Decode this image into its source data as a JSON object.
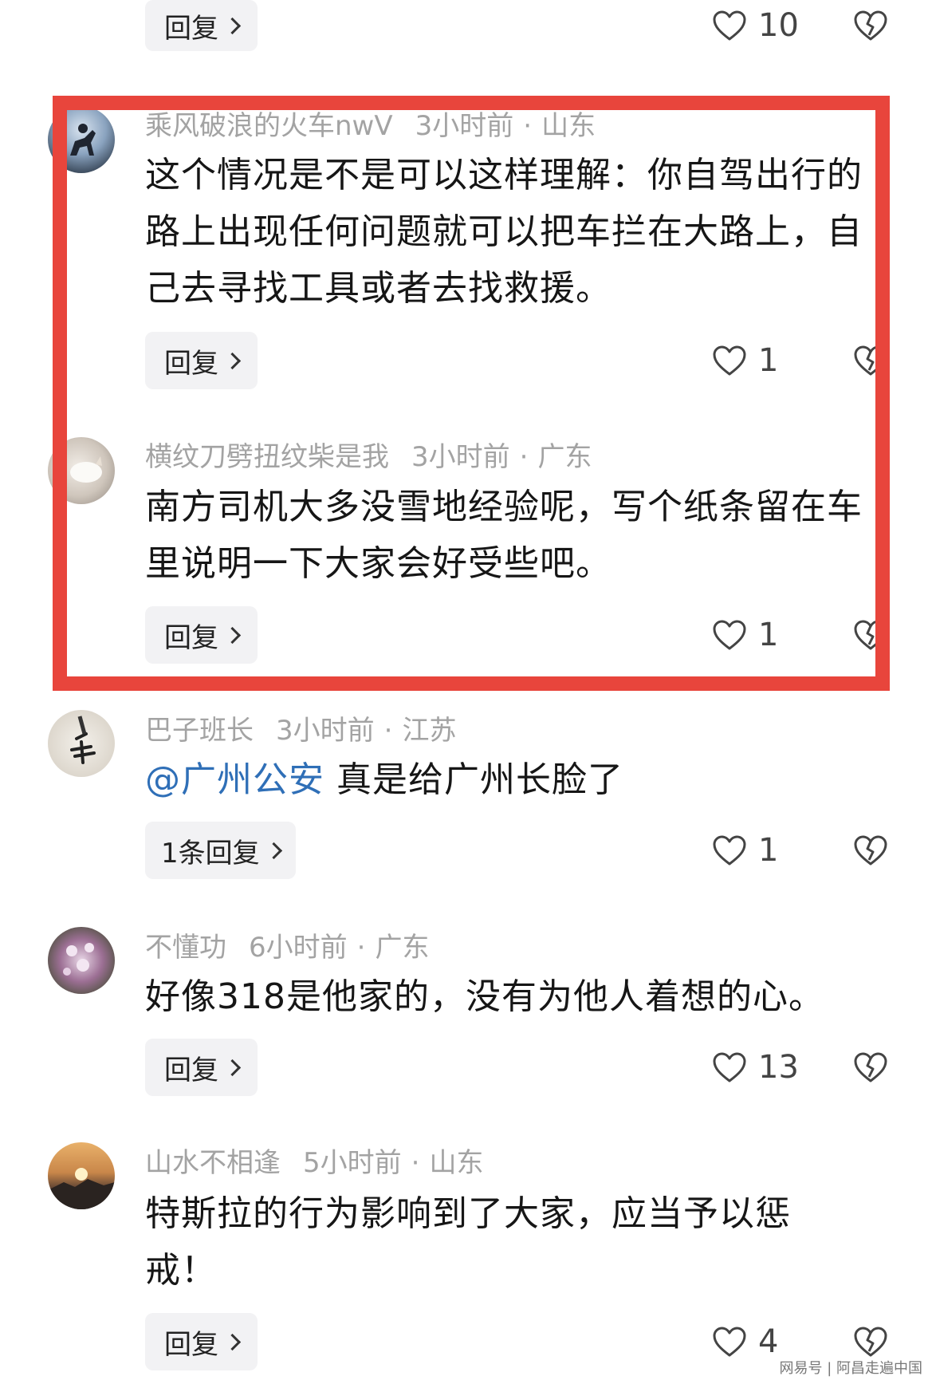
{
  "top_action_row": {
    "reply_label": "回复",
    "like_count": "10"
  },
  "comments": [
    {
      "username": "乘风破浪的火车nwV",
      "time": "3小时前",
      "location": "山东",
      "text": "这个情况是不是可以这样理解：你自驾出行的路上出现任何问题就可以把车拦在大路上，自己去寻找工具或者去找救援。",
      "reply_label": "回复",
      "like_count": "1"
    },
    {
      "username": "横纹刀劈扭纹柴是我",
      "time": "3小时前",
      "location": "广东",
      "text": "南方司机大多没雪地经验呢，写个纸条留在车里说明一下大家会好受些吧。",
      "reply_label": "回复",
      "like_count": "1"
    },
    {
      "username": "巴子班长",
      "time": "3小时前",
      "location": "江苏",
      "mention": "@广州公安",
      "text": " 真是给广州长脸了",
      "reply_label": "1条回复",
      "like_count": "1"
    },
    {
      "username": "不懂功",
      "time": "6小时前",
      "location": "广东",
      "text": "好像318是他家的，没有为他人着想的心。",
      "reply_label": "回复",
      "like_count": "13"
    },
    {
      "username": "山水不相逢",
      "time": "5小时前",
      "location": "山东",
      "text": "特斯拉的行为影响到了大家，应当予以惩戒！",
      "reply_label": "回复",
      "like_count": "4"
    }
  ],
  "meta_separator": "·",
  "watermark": "网易号 | 阿昌走遍中国",
  "colors": {
    "highlight": "#e8453c",
    "mention": "#2f6fb7",
    "meta": "#a3a3a3",
    "reply_bg": "#f2f2f4"
  },
  "icons": [
    "heart-icon",
    "broken-heart-icon",
    "chevron-right-icon"
  ]
}
